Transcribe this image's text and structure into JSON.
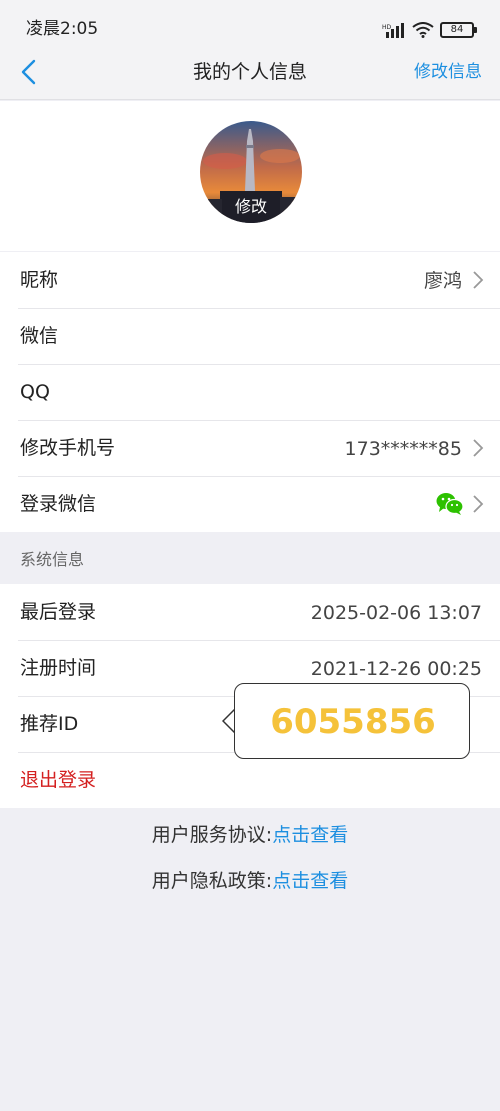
{
  "status": {
    "time": "凌晨2:05",
    "battery": "84"
  },
  "nav": {
    "title": "我的个人信息",
    "action": "修改信息"
  },
  "avatar": {
    "label": "修改"
  },
  "profile_rows": [
    {
      "label": "昵称",
      "value": "廖鸿"
    },
    {
      "label": "微信",
      "value": ""
    },
    {
      "label": "QQ",
      "value": ""
    },
    {
      "label": "修改手机号",
      "value": "173******85"
    },
    {
      "label": "登录微信",
      "value": ""
    }
  ],
  "section": {
    "title": "系统信息"
  },
  "system_rows": [
    {
      "label": "最后登录",
      "value": "2025-02-06 13:07"
    },
    {
      "label": "注册时间",
      "value": "2021-12-26 00:25"
    },
    {
      "label": "推荐ID",
      "value": ""
    },
    {
      "label": "退出登录",
      "value": ""
    }
  ],
  "popover": {
    "value": "6055856"
  },
  "links": [
    {
      "label": "用户服务协议:",
      "link": "点击查看"
    },
    {
      "label": "用户隐私政策:",
      "link": "点击查看"
    }
  ],
  "colors": {
    "accent": "#1d8fe0",
    "danger": "#d42020",
    "highlight": "#f5c23a",
    "wechat": "#2dc100"
  }
}
